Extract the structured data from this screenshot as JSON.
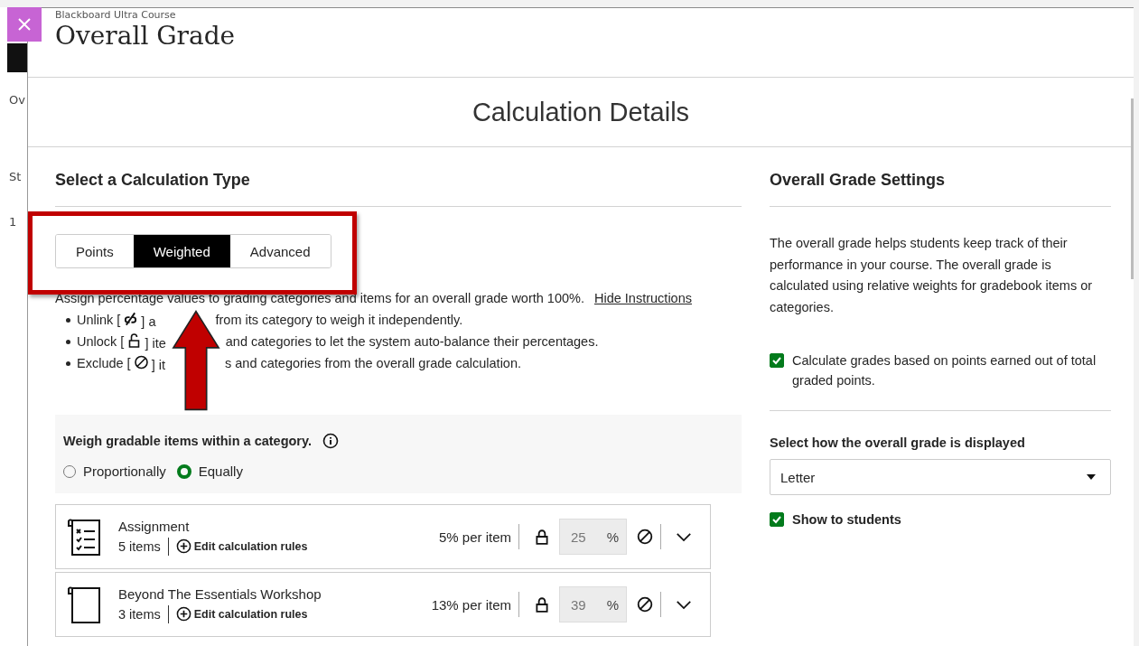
{
  "background_page": {
    "fragments": [
      "Ov",
      "St",
      "1"
    ]
  },
  "modal": {
    "breadcrumb": "Blackboard Ultra Course",
    "title": "Overall Grade",
    "subtitle": "Calculation Details"
  },
  "calculation": {
    "heading": "Select a Calculation Type",
    "types": [
      {
        "label": "Points",
        "selected": false
      },
      {
        "label": "Weighted",
        "selected": true
      },
      {
        "label": "Advanced",
        "selected": false
      }
    ],
    "instructions": "Assign percentage values to grading categories and items for an overall grade worth 100%.",
    "hide_link": "Hide Instructions",
    "bullets": [
      {
        "kind": "unlink",
        "before": "Unlink [",
        "after": "] a",
        "rest": "from its category to weigh it independently."
      },
      {
        "kind": "unlock",
        "before": "Unlock [",
        "after": "] ite",
        "rest": "and categories to let the system auto-balance their percentages."
      },
      {
        "kind": "exclude",
        "before": "Exclude [",
        "after": "] it",
        "rest": "s and categories from the overall grade calculation."
      }
    ],
    "weigh": {
      "label": "Weigh gradable items within a category.",
      "options": [
        {
          "label": "Proportionally",
          "selected": false
        },
        {
          "label": "Equally",
          "selected": true
        }
      ]
    },
    "categories": [
      {
        "kind": "checklist",
        "name": "Assignment",
        "count": "5 items",
        "edit": "Edit calculation rules",
        "per_item": "5% per item",
        "value": "25",
        "unit": "%"
      },
      {
        "kind": "blank",
        "name": "Beyond The Essentials Workshop",
        "count": "3 items",
        "edit": "Edit calculation rules",
        "per_item": "13% per item",
        "value": "39",
        "unit": "%"
      }
    ]
  },
  "settings": {
    "heading": "Overall Grade Settings",
    "description": "The overall grade helps students keep track of their performance in your course. The overall grade is calculated using relative weights for gradebook items or categories.",
    "points_checkbox": {
      "label": "Calculate grades based on points earned out of total graded points.",
      "checked": true
    },
    "display_label": "Select how the overall grade is displayed",
    "display_value": "Letter",
    "show_checkbox": {
      "label": "Show to students",
      "checked": true
    }
  }
}
